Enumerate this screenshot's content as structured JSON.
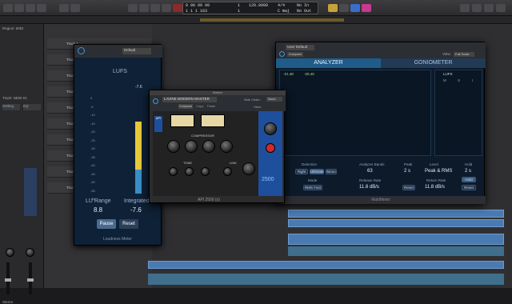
{
  "top": {
    "lcd_time": "0 00 00 00",
    "lcd_bars": "1 1 1 183",
    "lcd_tempo": "120.0000",
    "lcd_sig": "4/4",
    "lcd_key": "C maj",
    "lcd_out": "No Out",
    "lcd_in": "No In",
    "lcd_small1": "1",
    "lcd_small2": "1"
  },
  "inspector": {
    "region_label": "Region: MIDI",
    "track_label": "Track: NEW S1",
    "channel_top": "Setting",
    "eq": "EQ",
    "send": "Sends",
    "output": "Stereo Out",
    "read": "Read",
    "bottom_label": "Stereo"
  },
  "lufs_meter": {
    "preset": "Default",
    "title": "LUFS",
    "value_top": "-7.6",
    "scale": [
      "0",
      "-5",
      "-10",
      "-15",
      "-20",
      "-25",
      "-30",
      "-35",
      "-40",
      "-45",
      "-50",
      "-55",
      "-60"
    ],
    "lu_range_label": "LU Range",
    "lu_range_value": "8.8",
    "integrated_label": "Integrated",
    "integrated_value": "-7.6",
    "pause_label": "Pause",
    "reset_label": "Reset",
    "footer": "Loudness Meter"
  },
  "api_plugin": {
    "window_title": "Master",
    "preset": "LAVINE MODERN MASTER",
    "compare": "Compare",
    "copy": "Copy",
    "paste": "Paste",
    "side_chain": "Side Chain:",
    "side_chain_value": "None",
    "view": "View:",
    "compressor_label": "COMPRESSOR",
    "tone_label": "TONE",
    "link_label": "LINK",
    "brand": "API",
    "model": "2500",
    "footer": "API 2500 (s)"
  },
  "multimeter": {
    "preset": "User Default",
    "compare": "Compare",
    "view_label": "View:",
    "view_value": "Full Scale",
    "tab_analyzer": "ANALYZER",
    "tab_goniometer": "GONIOMETER",
    "peak_a": "-21.48",
    "peak_b": "-20.45",
    "lufs_label": "LUFS",
    "col_labels": [
      "M",
      "S",
      "I"
    ],
    "lower": {
      "detection": "Detection",
      "right": "Right",
      "ultimate": "Ultimate",
      "mono": "Mono",
      "mode": "Mode",
      "mode_value": "RMS Fast",
      "analyzer_bands": "Analyzer Bands",
      "bands_value": "63",
      "release": "Release Rate",
      "release_value": "11.8 dB/s",
      "peak": "Peak",
      "peak_value": "2 s",
      "level": "Level",
      "level_value": "Peak & RMS",
      "return_rate": "Return Rate",
      "return_value": "11.8 dB/s",
      "hold": "Hold",
      "hold_value": "2 s",
      "reset": "Reset",
      "hold_btn": "Hold"
    },
    "footer": "MultiMeter"
  },
  "tracks": {
    "names": [
      "Track 1",
      "Track 2",
      "Track 3",
      "Track 4",
      "Track 5",
      "Track 6",
      "Track 7",
      "Track 8",
      "Track 9",
      "Track 10"
    ]
  },
  "colors": {
    "accent_blue": "#3b9be0",
    "meter_yellow": "#e8c93a",
    "meter_blue": "#3a8fc7",
    "red_button": "#d22a2a"
  }
}
